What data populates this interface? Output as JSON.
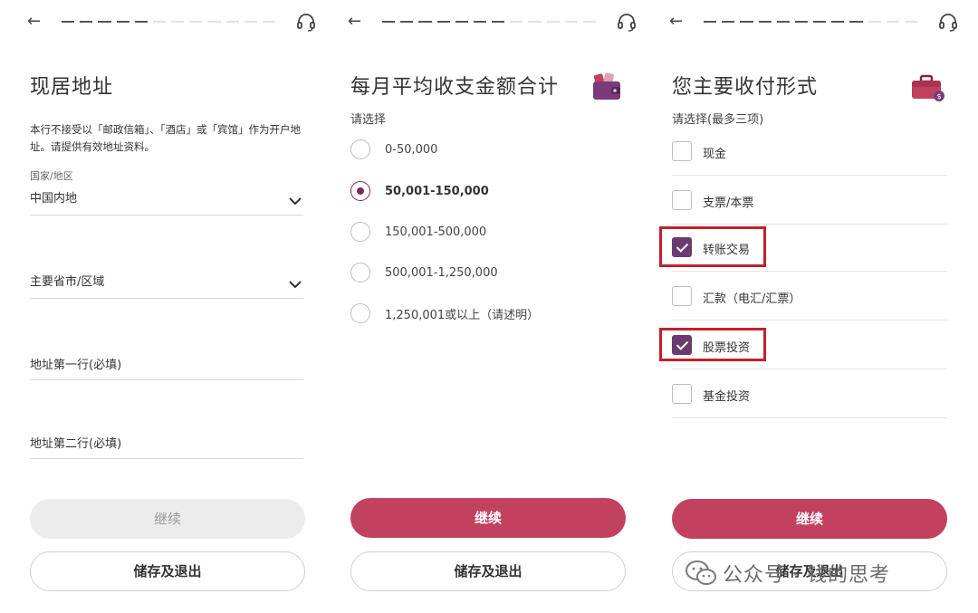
{
  "panel_address": {
    "title": "现居地址",
    "notice": "本行不接受以「邮政信箱」、「酒店」或「宾馆」作为开户地址。请提供有效地址资料。",
    "country_label": "国家/地区",
    "country_value": "中国内地",
    "province_placeholder": "主要省市/区域",
    "address_line1_placeholder": "地址第一行(必填)",
    "address_line2_placeholder": "地址第二行(必填)",
    "continue_label": "继续",
    "save_exit_label": "储存及退出",
    "progress_filled": 5,
    "progress_total": 12
  },
  "panel_income": {
    "title": "每月平均收支金额合计",
    "hint": "请选择",
    "options": [
      "0-50,000",
      "50,001-150,000",
      "150,001-500,000",
      "500,001-1,250,000",
      "1,250,001或以上（请述明）"
    ],
    "selected_option": "50,001-150,000",
    "continue_label": "继续",
    "save_exit_label": "储存及退出",
    "progress_filled": 7,
    "progress_total": 12
  },
  "panel_payment": {
    "title": "您主要收付形式",
    "hint": "请选择(最多三项)",
    "options": [
      "现金",
      "支票/本票",
      "转账交易",
      "汇款（电汇/汇票）",
      "股票投资",
      "基金投资"
    ],
    "checked": [
      "转账交易",
      "股票投资"
    ],
    "continue_label": "继续",
    "save_exit_label": "储存及退出",
    "progress_filled": 9,
    "progress_total": 12
  },
  "watermark": {
    "text": "公众号 · 钱的思考"
  },
  "colors": {
    "primary": "#c1415e",
    "check": "#6b3a6e",
    "highlight": "#c4202a"
  },
  "icons": [
    "back-arrow-icon",
    "headset-icon",
    "chevron-down-icon",
    "wallet-icon",
    "briefcase-icon",
    "wechat-icon"
  ]
}
